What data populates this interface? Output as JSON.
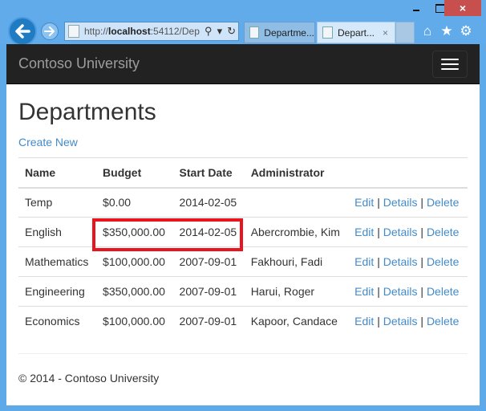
{
  "browser": {
    "url_prefix": "http://",
    "url_host": "localhost",
    "url_rest": ":54112/Dep",
    "tabs": [
      {
        "label": "Departme..."
      },
      {
        "label": "Depart...",
        "active": true
      }
    ],
    "window_controls": {
      "minimize": "minimize",
      "maximize": "maximize",
      "close": "×"
    },
    "icons": {
      "back": "←",
      "forward": "→",
      "search": "⚲",
      "dropdown": "▾",
      "refresh": "↻",
      "tab_close": "×",
      "home": "⌂",
      "favorites": "★",
      "tools": "⚙"
    }
  },
  "navbar": {
    "brand": "Contoso University",
    "toggle_icon": "hamburger-menu"
  },
  "page": {
    "title": "Departments",
    "create_new": "Create New"
  },
  "table": {
    "headers": [
      "Name",
      "Budget",
      "Start Date",
      "Administrator",
      ""
    ],
    "rows": [
      {
        "name": "Temp",
        "budget": "$0.00",
        "start_date": "2014-02-05",
        "administrator": "",
        "edit": "Edit",
        "details": "Details",
        "delete": "Delete"
      },
      {
        "name": "English",
        "budget": "$350,000.00",
        "start_date": "2014-02-05",
        "administrator": "Abercrombie, Kim",
        "edit": "Edit",
        "details": "Details",
        "delete": "Delete"
      },
      {
        "name": "Mathematics",
        "budget": "$100,000.00",
        "start_date": "2007-09-01",
        "administrator": "Fakhouri, Fadi",
        "edit": "Edit",
        "details": "Details",
        "delete": "Delete"
      },
      {
        "name": "Engineering",
        "budget": "$350,000.00",
        "start_date": "2007-09-01",
        "administrator": "Harui, Roger",
        "edit": "Edit",
        "details": "Details",
        "delete": "Delete"
      },
      {
        "name": "Economics",
        "budget": "$100,000.00",
        "start_date": "2007-09-01",
        "administrator": "Kapoor, Candace",
        "edit": "Edit",
        "details": "Details",
        "delete": "Delete"
      }
    ],
    "separator": "|"
  },
  "annotation": {
    "highlight_color": "#e8141e",
    "highlighted_row": "English",
    "highlighted_columns": [
      "Budget",
      "Start Date"
    ]
  },
  "footer": {
    "text": "© 2014 - Contoso University"
  },
  "colors": {
    "link": "#428bca",
    "navbar": "#222222",
    "chrome": "#62abeb",
    "close_button": "#c7504f"
  }
}
